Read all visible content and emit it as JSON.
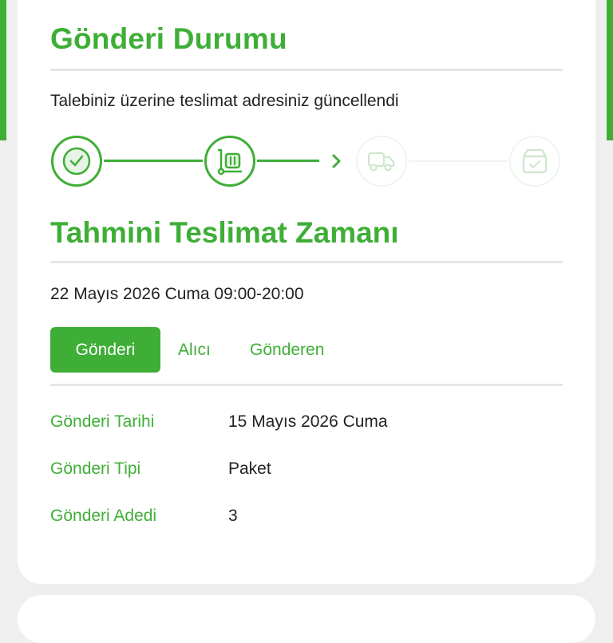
{
  "shipment_status": {
    "title": "Gönderi Durumu",
    "status_message": "Talebiniz üzerine teslimat adresiniz güncellendi"
  },
  "tracker": {
    "steps": [
      {
        "icon": "check-circle-icon",
        "state": "completed"
      },
      {
        "icon": "package-cart-icon",
        "state": "completed"
      },
      {
        "icon": "delivery-truck-icon",
        "state": "pending"
      },
      {
        "icon": "box-check-icon",
        "state": "pending"
      }
    ]
  },
  "estimated_delivery": {
    "title": "Tahmini Teslimat Zamanı",
    "value": "22 Mayıs 2026 Cuma 09:00-20:00"
  },
  "tabs": [
    {
      "label": "Gönderi",
      "selected": true
    },
    {
      "label": "Alıcı",
      "selected": false
    },
    {
      "label": "Gönderen",
      "selected": false
    }
  ],
  "details": [
    {
      "label": "Gönderi Tarihi",
      "value": "15 Mayıs 2026 Cuma"
    },
    {
      "label": "Gönderi Tipi",
      "value": "Paket"
    },
    {
      "label": "Gönderi Adedi",
      "value": "3"
    }
  ],
  "colors": {
    "primary": "#3fae37",
    "text": "#222222",
    "divider": "#e6e6e6",
    "pending": "#eef5ee",
    "background": "#efefef"
  }
}
